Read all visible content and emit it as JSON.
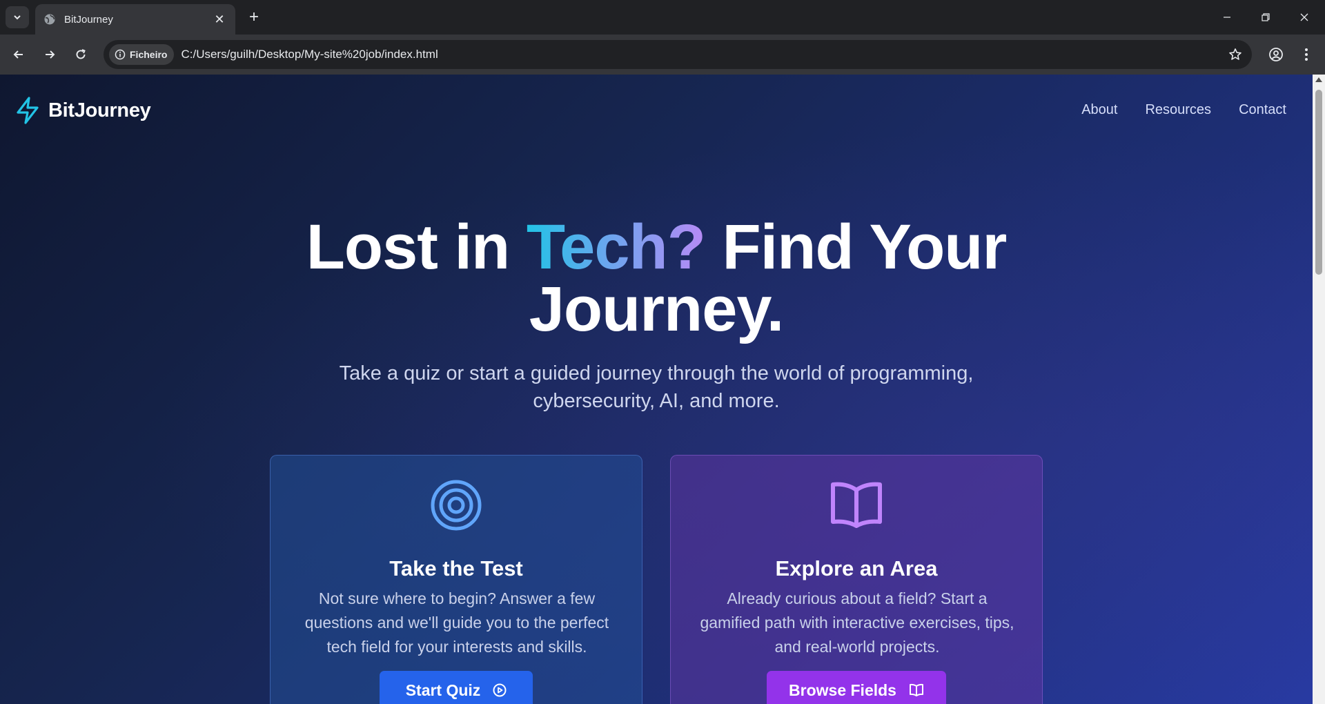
{
  "browser": {
    "tab_title": "BitJourney",
    "security_chip": "Ficheiro",
    "url": "C:/Users/guilh/Desktop/My-site%20job/index.html"
  },
  "site": {
    "logo_text": "BitJourney",
    "nav": [
      "About",
      "Resources",
      "Contact"
    ]
  },
  "hero": {
    "title_part1": "Lost in ",
    "title_accent": "Tech?",
    "title_part2": " Find Your",
    "title_line2": "Journey.",
    "subtitle": "Take a quiz or start a guided journey through the world of programming, cybersecurity, AI, and more."
  },
  "cards": [
    {
      "icon": "target-icon",
      "title": "Take the Test",
      "description": "Not sure where to begin? Answer a few questions and we'll guide you to the perfect tech field for your interests and skills.",
      "button_label": "Start Quiz",
      "button_icon": "play-circle-icon"
    },
    {
      "icon": "book-open-icon",
      "title": "Explore an Area",
      "description": "Already curious about a field? Start a gamified path with interactive exercises, tips, and real-world projects.",
      "button_label": "Browse Fields",
      "button_icon": "book-icon"
    }
  ],
  "colors": {
    "logo_accent": "#22c3e6",
    "quiz_button": "#2563eb",
    "browse_button": "#9333ea",
    "target_icon": "#60a5fa",
    "book_icon": "#c084fc"
  }
}
